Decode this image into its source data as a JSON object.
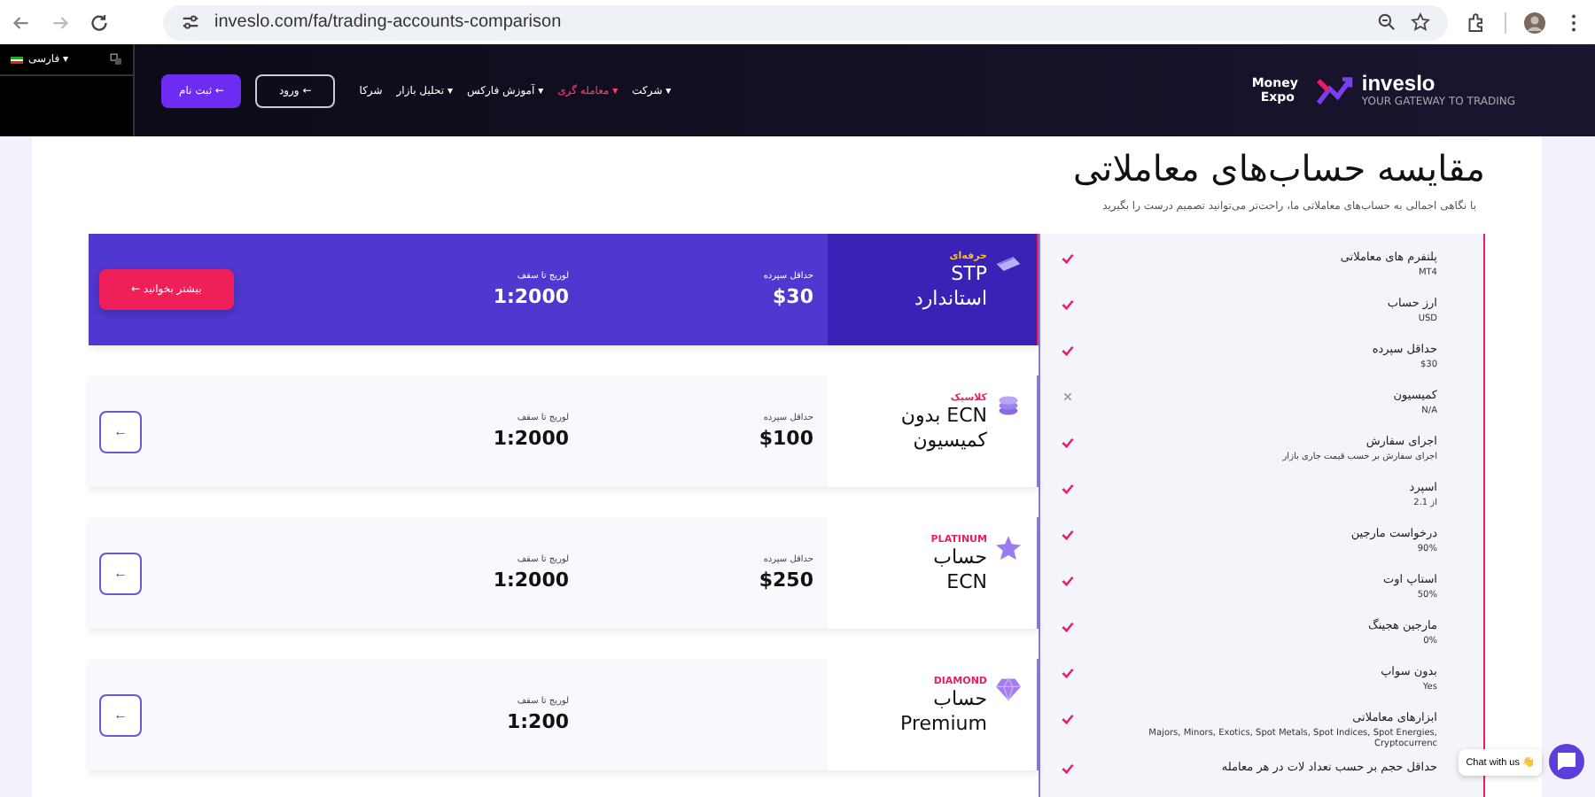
{
  "browser": {
    "url": "inveslo.com/fa/trading-accounts-comparison"
  },
  "sidebar": {
    "language": "فارسی ▾"
  },
  "nav": {
    "logo": "inveslo",
    "logo_tagline": "YOUR GATEWAY TO TRADING",
    "expo_logo": [
      "Money",
      "Expo"
    ],
    "items": [
      {
        "label": "شرکت ▾",
        "selected": false
      },
      {
        "label": "معامله گری ▾",
        "selected": true
      },
      {
        "label": "آموزش فارکس ▾",
        "selected": false
      },
      {
        "label": "تحلیل بازار ▾",
        "selected": false
      },
      {
        "label": "شرکا",
        "selected": false
      }
    ],
    "login": "ورود ←",
    "signup": "ثبت نام ←"
  },
  "title": "مقایسه حساب‌های معاملاتی",
  "subtitle": "با نگاهی اجمالی به حساب‌های معاملاتی ما، راحت‌تر می‌توانید تصمیم درست را بگیرید",
  "features": [
    {
      "name": "پلتفرم های معاملاتی",
      "value": "MT4",
      "ok": true
    },
    {
      "name": "ارز حساب",
      "value": "USD",
      "ok": true
    },
    {
      "name": "حداقل سپرده",
      "value": "$30",
      "ok": true
    },
    {
      "name": "کمیسیون",
      "value": "N/A",
      "ok": false
    },
    {
      "name": "اجرای سفارش",
      "value": "اجرای سفارش بر حسب قیمت جاری بازار",
      "ok": true
    },
    {
      "name": "اسپرد",
      "value": "از 2.1",
      "ok": true
    },
    {
      "name": "درخواست مارجین",
      "value": "90%",
      "ok": true
    },
    {
      "name": "استاپ اوت",
      "value": "50%",
      "ok": true
    },
    {
      "name": "مارجین هجینگ",
      "value": "0%",
      "ok": true
    },
    {
      "name": "بدون سواپ",
      "value": "Yes",
      "ok": true
    },
    {
      "name": "ابزارهای معاملاتی",
      "value": "Majors, Minors, Exotics, Spot Metals, Spot Indices, Spot Energies, Cryptocurrenc",
      "ok": true
    },
    {
      "name": "حداقل حجم بر حسب تعداد لات در هر معامله",
      "ok": true
    }
  ],
  "accounts": [
    {
      "tier": "حرفه‌ای",
      "kind": "card",
      "name": [
        "STP",
        "استاندارد"
      ],
      "deposit_label": "حداقل سپرده",
      "deposit": "$30",
      "leverage_label": "لوریج تا سقف",
      "leverage": "1:2000",
      "selected": true,
      "button": "بیشتر بخوانید ←"
    },
    {
      "tier": "کلاسیک",
      "kind": "coins",
      "name": [
        "ECN بدون",
        "کمیسیون"
      ],
      "deposit_label": "حداقل سپرده",
      "deposit": "$100",
      "leverage_label": "لوریج تا سقف",
      "leverage": "1:2000",
      "selected": false,
      "arrow": "←"
    },
    {
      "tier": "PLATINUM",
      "kind": "star",
      "name": [
        "حساب",
        "ECN"
      ],
      "deposit_label": "حداقل سپرده",
      "deposit": "$250",
      "leverage_label": "لوریج تا سقف",
      "leverage": "1:2000",
      "selected": false,
      "arrow": "←"
    },
    {
      "tier": "DIAMOND",
      "kind": "gem",
      "name": [
        "حساب",
        "Premium"
      ],
      "leverage_label": "لوریج تا سقف",
      "leverage": "1:200",
      "selected": false,
      "arrow": "←"
    }
  ],
  "chat": {
    "label": "Chat with us 👋"
  }
}
